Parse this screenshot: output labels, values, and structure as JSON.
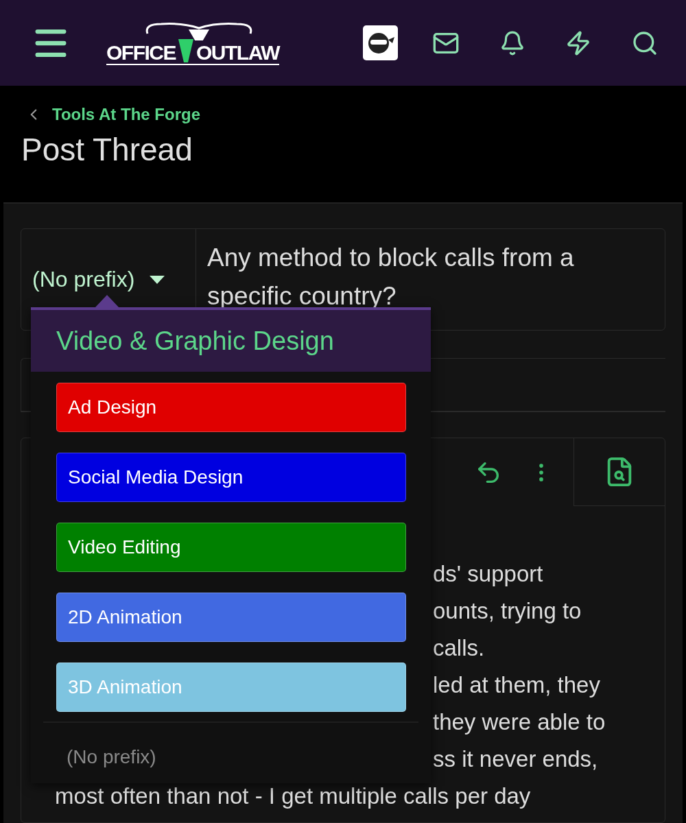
{
  "header": {
    "logo": {
      "left": "OFFICE",
      "right": "OUTLAW"
    }
  },
  "breadcrumb": {
    "label": "Tools At The Forge"
  },
  "page_title": "Post Thread",
  "thread_title": {
    "prefix": "(No prefix)",
    "value": "Any method to block calls from a specific country?"
  },
  "prefix_menu": {
    "group": "Video & Graphic Design",
    "options": [
      {
        "label": "Ad Design",
        "color": "#e00000"
      },
      {
        "label": "Social Media Design",
        "color": "#0000e0"
      },
      {
        "label": "Video Editing",
        "color": "#008000"
      },
      {
        "label": "2D Animation",
        "color": "#4169e1"
      },
      {
        "label": "3D Animation",
        "color": "#7ec4e0"
      }
    ],
    "none_option": "(No prefix)"
  },
  "editor": {
    "lines": [
      {
        "kind": "partial",
        "text": "ds' support"
      },
      {
        "kind": "partial",
        "text": "ounts, trying to"
      },
      {
        "kind": "partial",
        "text": "calls."
      },
      {
        "kind": "partial",
        "text": "led at them, they"
      },
      {
        "kind": "partial",
        "text": "they were able to"
      },
      {
        "kind": "partial",
        "text": "ss it never ends,"
      },
      {
        "kind": "full",
        "text": "most often than not - I get multiple calls per day"
      }
    ]
  }
}
